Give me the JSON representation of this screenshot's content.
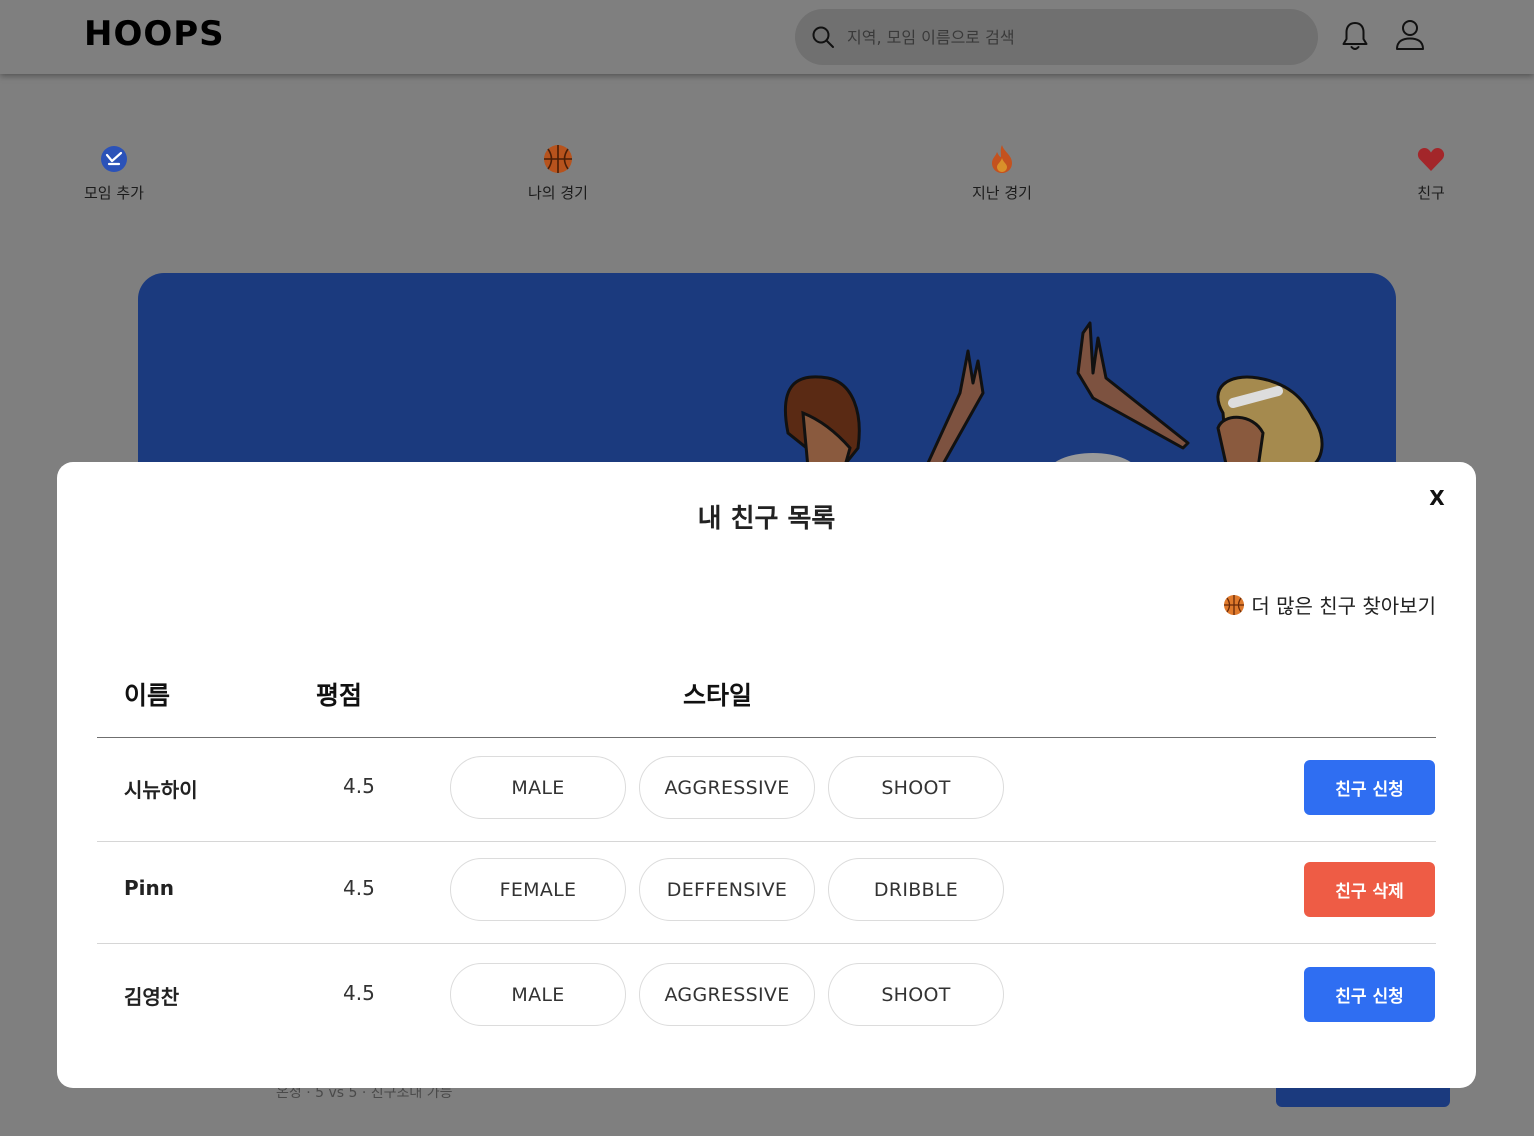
{
  "header": {
    "logo": "HOOPS",
    "search_placeholder": "지역, 모임 이름으로 검색",
    "icons": [
      "search-icon",
      "bell-icon",
      "user-icon"
    ]
  },
  "quick_menu": [
    {
      "label": "모임 추가",
      "icon": "add-meeting-icon"
    },
    {
      "label": "나의 경기",
      "icon": "basketball-icon"
    },
    {
      "label": "지난 경기",
      "icon": "fire-icon"
    },
    {
      "label": "친구",
      "icon": "heart-icon"
    }
  ],
  "background_meta": "온정 · 5 vs 5 · 친구초대 가능",
  "modal": {
    "title": "내 친구 목록",
    "close_label": "X",
    "find_more": "더 많은 친구 찾아보기",
    "columns": {
      "name": "이름",
      "rating": "평점",
      "style": "스타일"
    },
    "rows": [
      {
        "name": "시뉴하이",
        "rating": "4.5",
        "tags": [
          "MALE",
          "AGGRESSIVE",
          "SHOOT"
        ],
        "action": "친구 신청",
        "action_type": "request"
      },
      {
        "name": "Pinn",
        "rating": "4.5",
        "tags": [
          "FEMALE",
          "DEFFENSIVE",
          "DRIBBLE"
        ],
        "action": "친구 삭제",
        "action_type": "delete"
      },
      {
        "name": "김영찬",
        "rating": "4.5",
        "tags": [
          "MALE",
          "AGGRESSIVE",
          "SHOOT"
        ],
        "action": "친구 신청",
        "action_type": "request"
      }
    ]
  },
  "colors": {
    "request_button": "#2f6ef2",
    "delete_button": "#ee5c45",
    "banner": "#1b3a7e",
    "overlay": "#7f7f7f"
  }
}
